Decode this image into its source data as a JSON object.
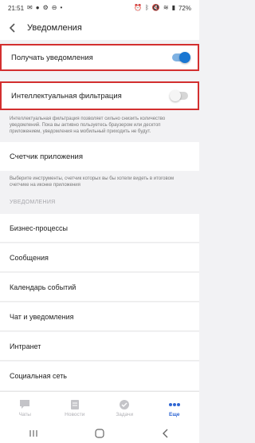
{
  "status_bar": {
    "time": "21:51",
    "battery": "72%"
  },
  "app_bar": {
    "title": "Уведомления"
  },
  "settings": {
    "receive_label": "Получать уведомления",
    "receive_on": true,
    "filter_label": "Интеллектуальная фильтрация",
    "filter_on": false,
    "filter_note": "Интеллектуальная фильтрация позволяет сильно снизить количество уведомлений. Пока вы активно пользуетесь браузером или десктоп приложением, уведомления на мобильный приходить не будут.",
    "counter_label": "Счетчик приложения",
    "counter_note": "Выберите инструменты, счетчик которых вы бы хотели видеть в итоговом счетчике на иконке приложения"
  },
  "section": {
    "header": "УВЕДОМЛЕНИЯ",
    "items": [
      "Бизнес-процессы",
      "Сообщения",
      "Календарь событий",
      "Чат и уведомления",
      "Интранет",
      "Социальная сеть"
    ]
  },
  "tabbar": {
    "tabs": [
      {
        "label": "Чаты",
        "icon": "chat-icon"
      },
      {
        "label": "Новости",
        "icon": "news-icon"
      },
      {
        "label": "Задачи",
        "icon": "tasks-icon"
      },
      {
        "label": "Еще",
        "icon": "more-icon"
      }
    ],
    "active_index": 3
  },
  "colors": {
    "accent": "#1976d2",
    "highlight_border": "#d32f2f",
    "active_tab": "#2f66d3"
  }
}
